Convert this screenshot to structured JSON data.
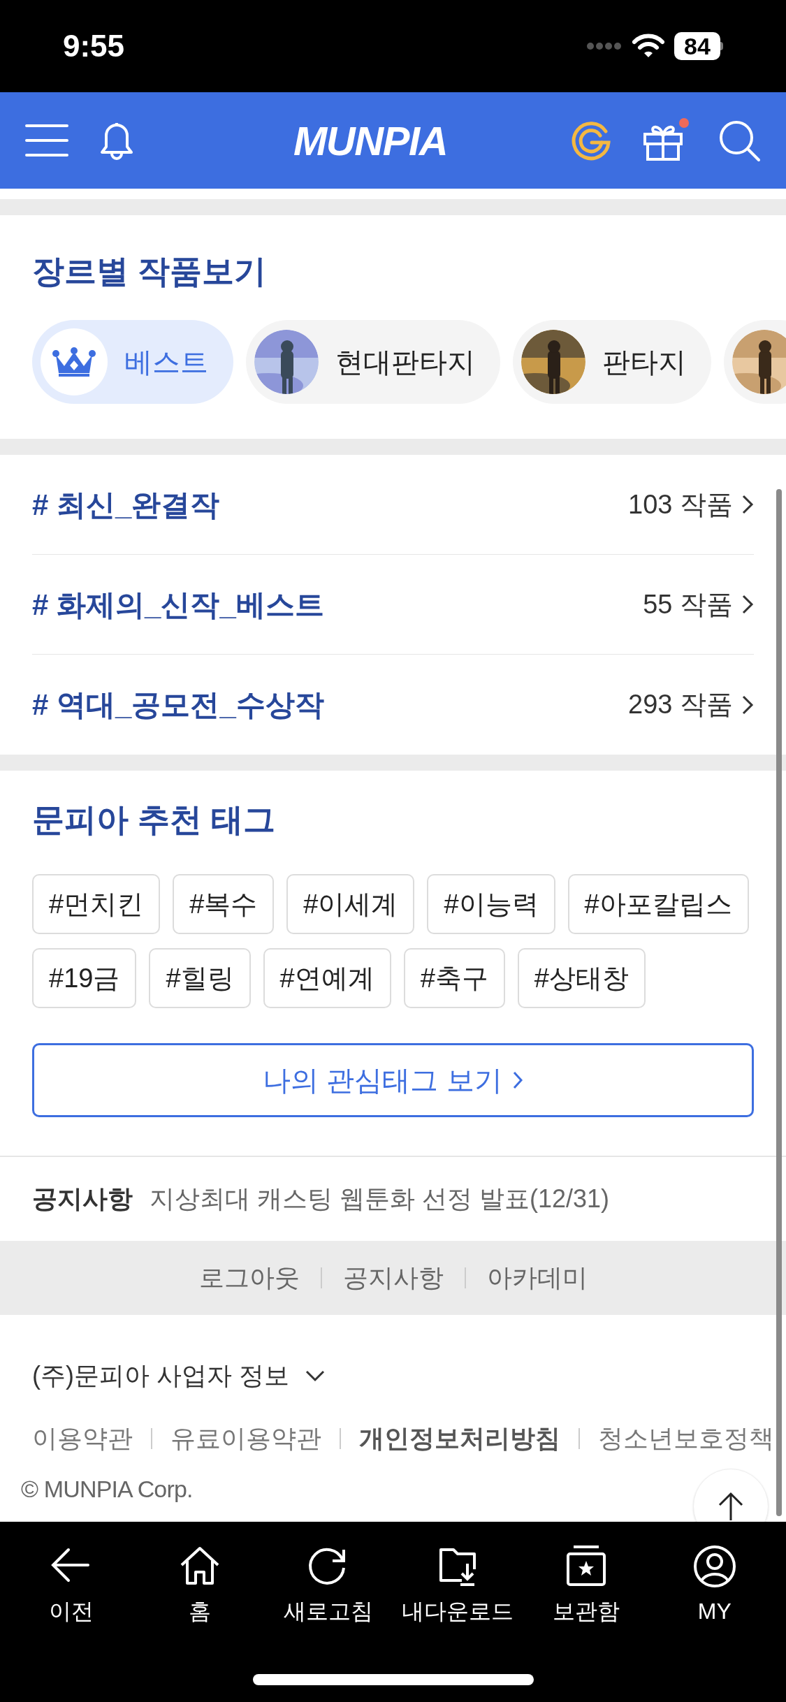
{
  "status_bar": {
    "time": "9:55",
    "battery": "84"
  },
  "header": {
    "logo": "MUNPIA",
    "has_gift_dot": true
  },
  "genre_section": {
    "title": "장르별 작품보기",
    "chips": [
      {
        "kind": "icon",
        "label": "베스트",
        "selected": true
      },
      {
        "kind": "picture",
        "label": "현대판타지",
        "selected": false
      },
      {
        "kind": "picture",
        "label": "판타지",
        "selected": false
      },
      {
        "kind": "picture",
        "selected": false
      }
    ]
  },
  "hashtag_lists": [
    {
      "label": "# 최신_완결작",
      "count": "103 작품"
    },
    {
      "label": "# 화제의_신작_베스트",
      "count": "55 작품"
    },
    {
      "label": "# 역대_공모전_수상작",
      "count": "293 작품"
    }
  ],
  "recommended_tags": {
    "title": "문피아 추천 태그",
    "rows": [
      [
        "#먼치킨",
        "#복수",
        "#이세계",
        "#이능력",
        "#아포칼립스"
      ],
      [
        "#19금",
        "#힐링",
        "#연예계",
        "#축구",
        "#상태창"
      ]
    ],
    "button": "나의 관심태그 보기"
  },
  "notice": {
    "label": "공지사항",
    "text": "지상최대 캐스팅 웹툰화 선정 발표(12/31)"
  },
  "footer_links": [
    "로그아웃",
    "공지사항",
    "아카데미"
  ],
  "business_info": {
    "title": "(주)문피아 사업자 정보",
    "links": [
      {
        "label": "이용약관",
        "bold": false
      },
      {
        "label": "유료이용약관",
        "bold": false
      },
      {
        "label": "개인정보처리방침",
        "bold": true
      },
      {
        "label": "청소년보호정책",
        "bold": false
      }
    ],
    "copyright": "© MUNPIA Corp."
  },
  "bottom_nav": [
    {
      "kind": "back",
      "label": "이전"
    },
    {
      "kind": "home",
      "label": "홈"
    },
    {
      "kind": "refresh",
      "label": "새로고침"
    },
    {
      "kind": "download",
      "label": "내다운로드"
    },
    {
      "kind": "library",
      "label": "보관함"
    },
    {
      "kind": "profile",
      "label": "MY"
    }
  ]
}
